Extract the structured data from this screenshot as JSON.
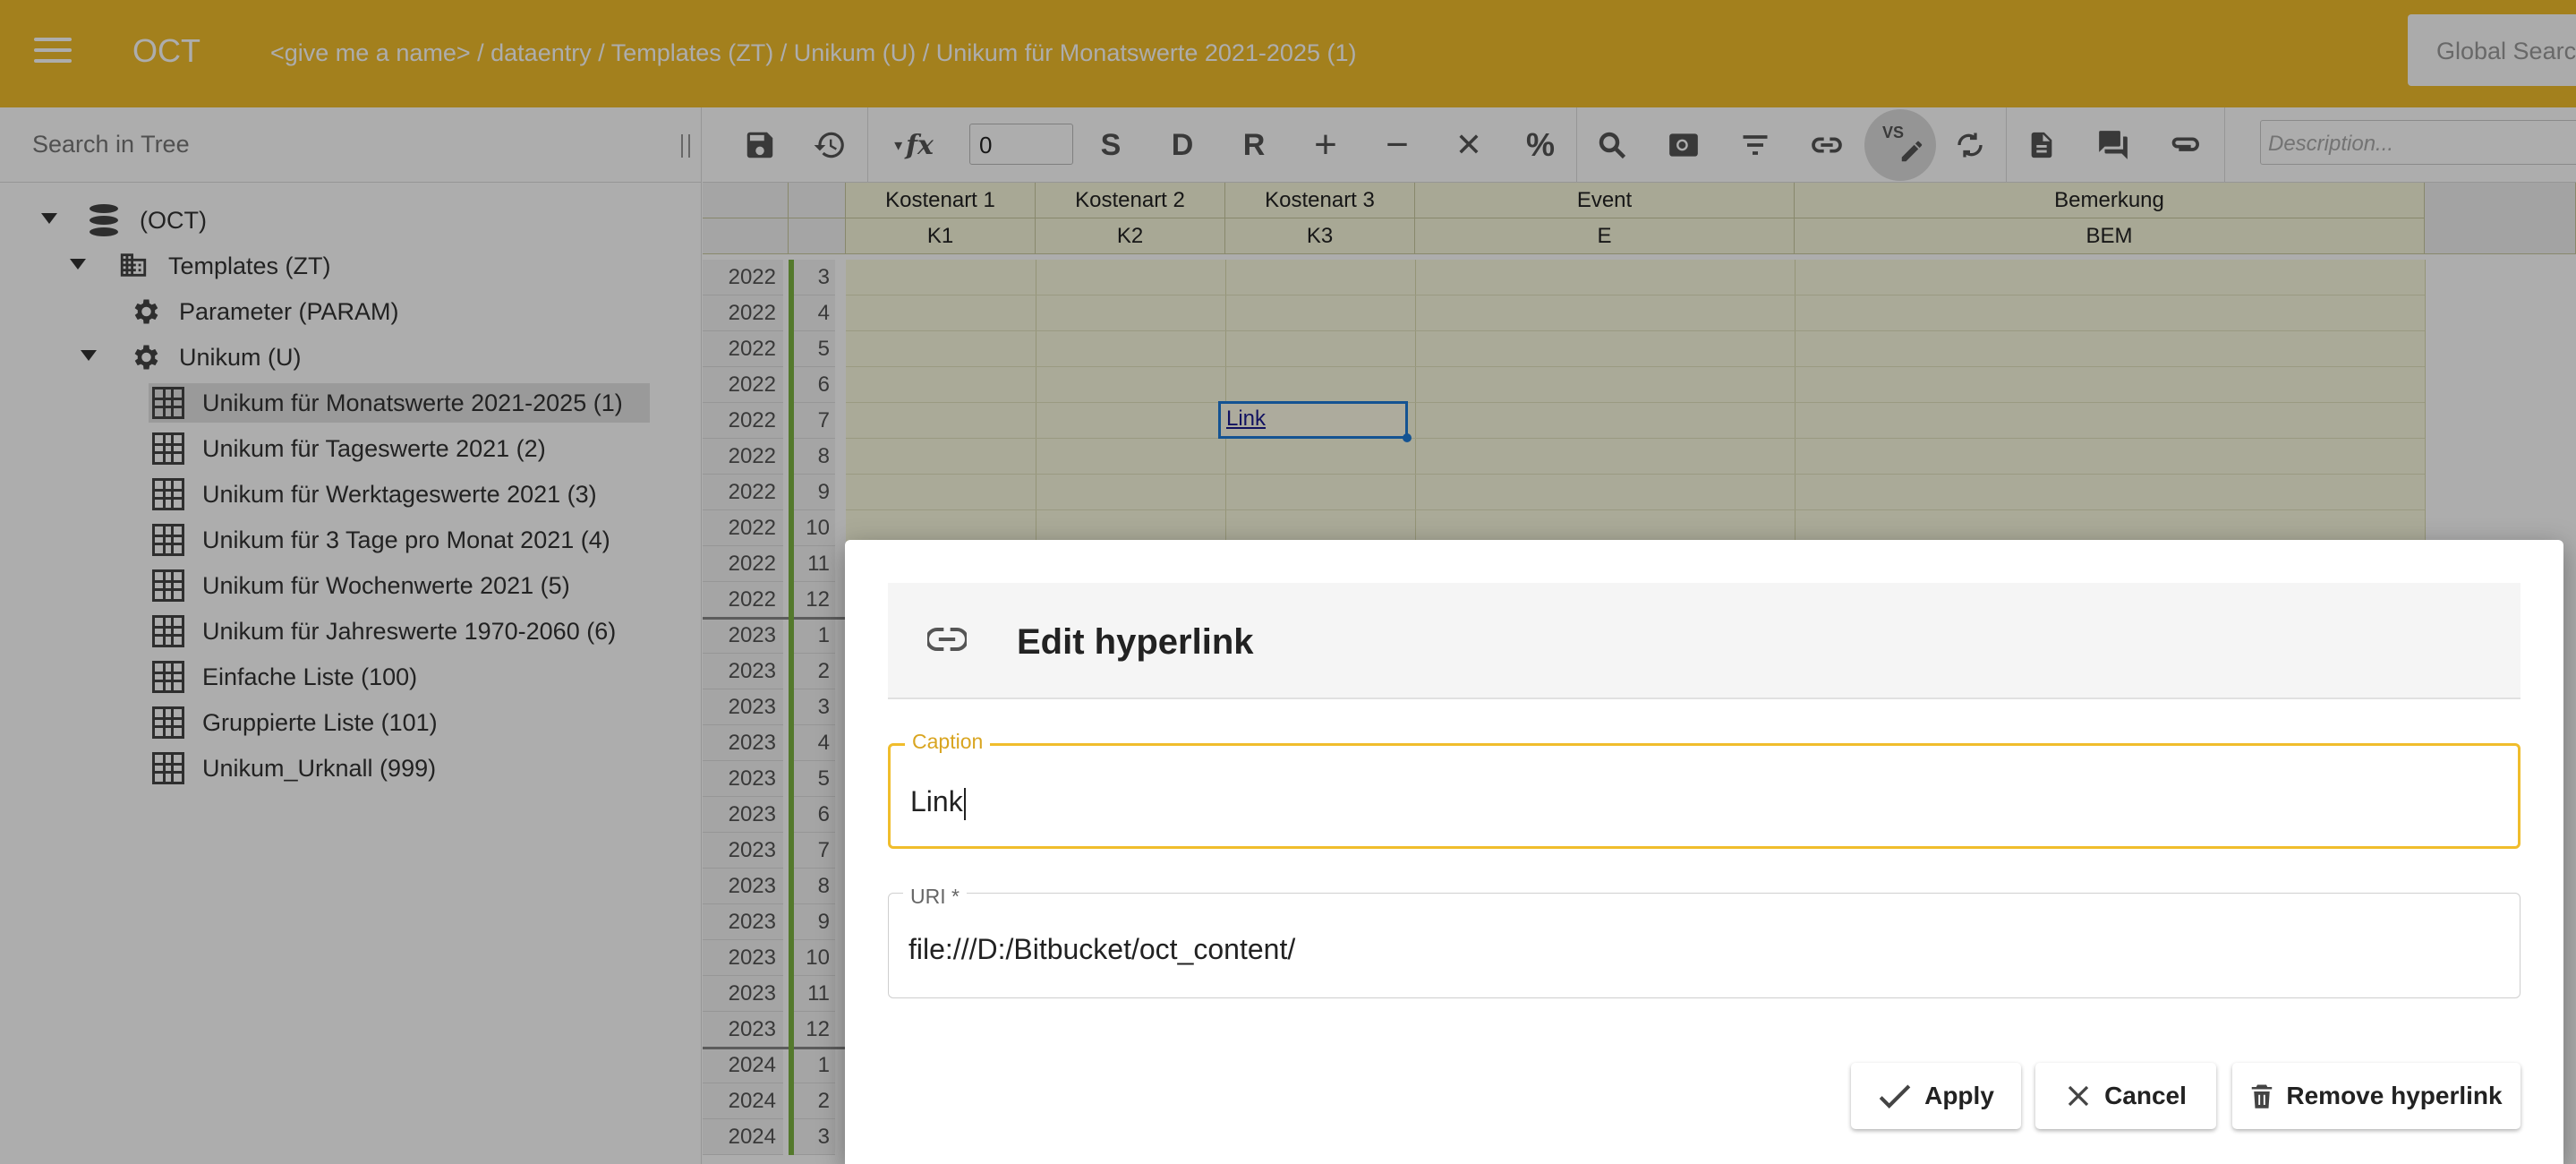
{
  "app": {
    "title": "OCT",
    "breadcrumb": "<give me a name> / dataentry / Templates (ZT) / Unikum (U) / Unikum für Monatswerte 2021-2025 (1)",
    "global_search_label": "Global Search"
  },
  "tree": {
    "search_placeholder": "Search in Tree",
    "items": [
      {
        "label": "(OCT)",
        "icon": "database-icon",
        "expanded": true
      },
      {
        "label": "Templates (ZT)",
        "icon": "building-icon",
        "expanded": true
      },
      {
        "label": "Parameter (PARAM)",
        "icon": "gear-icon"
      },
      {
        "label": "Unikum (U)",
        "icon": "gear-icon",
        "expanded": true
      },
      {
        "label": "Unikum für Monatswerte 2021-2025 (1)",
        "icon": "grid-icon",
        "selected": true
      },
      {
        "label": "Unikum für Tageswerte 2021 (2)",
        "icon": "grid-icon"
      },
      {
        "label": "Unikum für Werktageswerte 2021 (3)",
        "icon": "grid-icon"
      },
      {
        "label": "Unikum für 3 Tage pro Monat 2021 (4)",
        "icon": "grid-icon"
      },
      {
        "label": "Unikum für Wochenwerte 2021 (5)",
        "icon": "grid-icon"
      },
      {
        "label": "Unikum für Jahreswerte 1970-2060 (6)",
        "icon": "grid-icon"
      },
      {
        "label": "Einfache Liste (100)",
        "icon": "grid-icon"
      },
      {
        "label": "Gruppierte Liste (101)",
        "icon": "grid-icon"
      },
      {
        "label": "Unikum_Urknall (999)",
        "icon": "grid-icon"
      }
    ]
  },
  "toolbar": {
    "precision_value": "0",
    "fx_label": "fx",
    "s_label": "S",
    "d_label": "D",
    "r_label": "R",
    "plus_label": "+",
    "minus_label": "−",
    "times_label": "✕",
    "percent_label": "%",
    "vs_label": "VS",
    "description_placeholder": "Description..."
  },
  "grid": {
    "columns": [
      {
        "title": "Kostenart 1",
        "code": "K1"
      },
      {
        "title": "Kostenart 2",
        "code": "K2"
      },
      {
        "title": "Kostenart 3",
        "code": "K3"
      },
      {
        "title": "Event",
        "code": "E"
      },
      {
        "title": "Bemerkung",
        "code": "BEM"
      }
    ],
    "rows": [
      {
        "year": "2022",
        "month": "3"
      },
      {
        "year": "2022",
        "month": "4"
      },
      {
        "year": "2022",
        "month": "5"
      },
      {
        "year": "2022",
        "month": "6"
      },
      {
        "year": "2022",
        "month": "7"
      },
      {
        "year": "2022",
        "month": "8"
      },
      {
        "year": "2022",
        "month": "9"
      },
      {
        "year": "2022",
        "month": "10"
      },
      {
        "year": "2022",
        "month": "11"
      },
      {
        "year": "2022",
        "month": "12"
      },
      {
        "year": "2023",
        "month": "1"
      },
      {
        "year": "2023",
        "month": "2"
      },
      {
        "year": "2023",
        "month": "3"
      },
      {
        "year": "2023",
        "month": "4"
      },
      {
        "year": "2023",
        "month": "5"
      },
      {
        "year": "2023",
        "month": "6"
      },
      {
        "year": "2023",
        "month": "7"
      },
      {
        "year": "2023",
        "month": "8"
      },
      {
        "year": "2023",
        "month": "9"
      },
      {
        "year": "2023",
        "month": "10"
      },
      {
        "year": "2023",
        "month": "11"
      },
      {
        "year": "2023",
        "month": "12"
      },
      {
        "year": "2024",
        "month": "1"
      },
      {
        "year": "2024",
        "month": "2"
      },
      {
        "year": "2024",
        "month": "3"
      }
    ],
    "link_cell_text": "Link"
  },
  "dialog": {
    "title": "Edit hyperlink",
    "caption_label": "Caption",
    "caption_value": "Link",
    "uri_label": "URI *",
    "uri_value": "file:///D:/Bitbucket/oct_content/",
    "apply_label": "Apply",
    "cancel_label": "Cancel",
    "remove_label": "Remove hyperlink"
  },
  "colors": {
    "accent": "#f0bd2c",
    "grid_cell": "#fbfbe0",
    "link_border": "#1e7bd8"
  }
}
